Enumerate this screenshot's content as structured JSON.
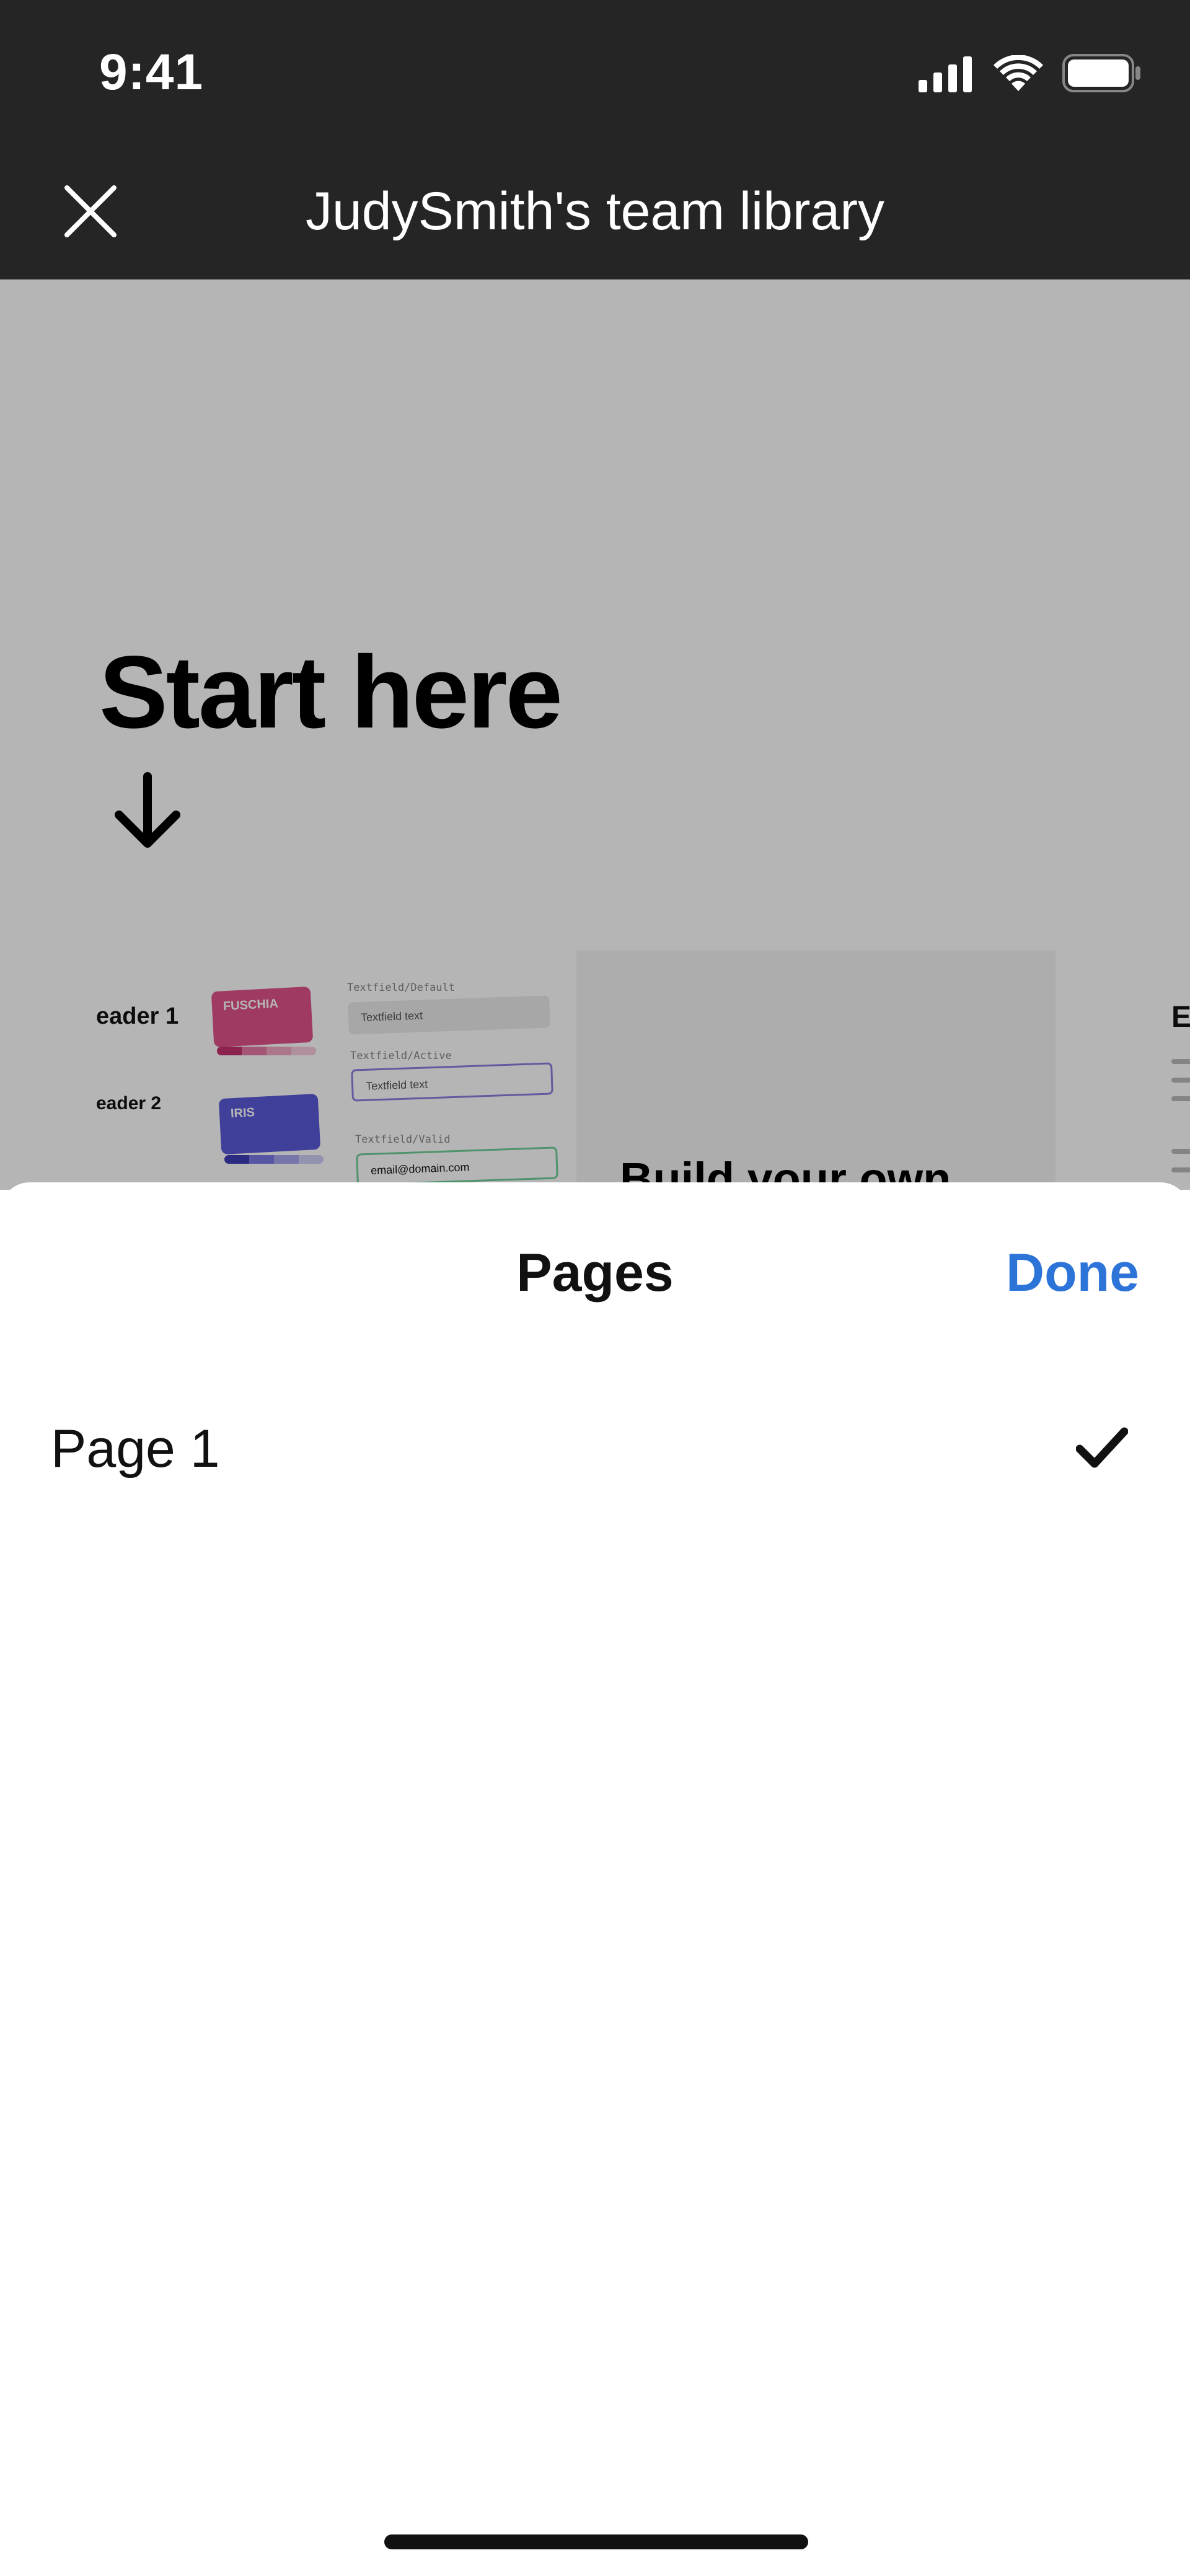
{
  "status_bar": {
    "time": "9:41",
    "icons": [
      "cellular-signal-icon",
      "wifi-icon",
      "battery-icon"
    ]
  },
  "nav": {
    "title": "JudySmith's team library",
    "close_icon": "close-icon"
  },
  "canvas": {
    "heading": "Start here",
    "arrow_icon": "arrow-down-icon",
    "thumbnail_1": {
      "header_1": "eader 1",
      "header_2": "eader 2",
      "swatch_1_label": "FUSCHIA",
      "swatch_2_label": "IRIS",
      "textfield_default_label": "Textfield/Default",
      "textfield_default_text": "Textfield text",
      "textfield_active_label": "Textfield/Active",
      "textfield_active_text": "Textfield text",
      "textfield_valid_label": "Textfield/Valid",
      "textfield_valid_text": "email@domain.com",
      "build_text": "Build your own"
    },
    "thumbnail_2": {
      "title": "E"
    }
  },
  "sheet": {
    "title": "Pages",
    "done_label": "Done",
    "pages": [
      {
        "label": "Page 1",
        "selected": true
      }
    ]
  },
  "colors": {
    "bar_bg": "#252525",
    "accent": "#2d74d8",
    "fuschia": "#e0548c",
    "iris": "#5b5bdb",
    "valid_green": "#6fcf97"
  }
}
